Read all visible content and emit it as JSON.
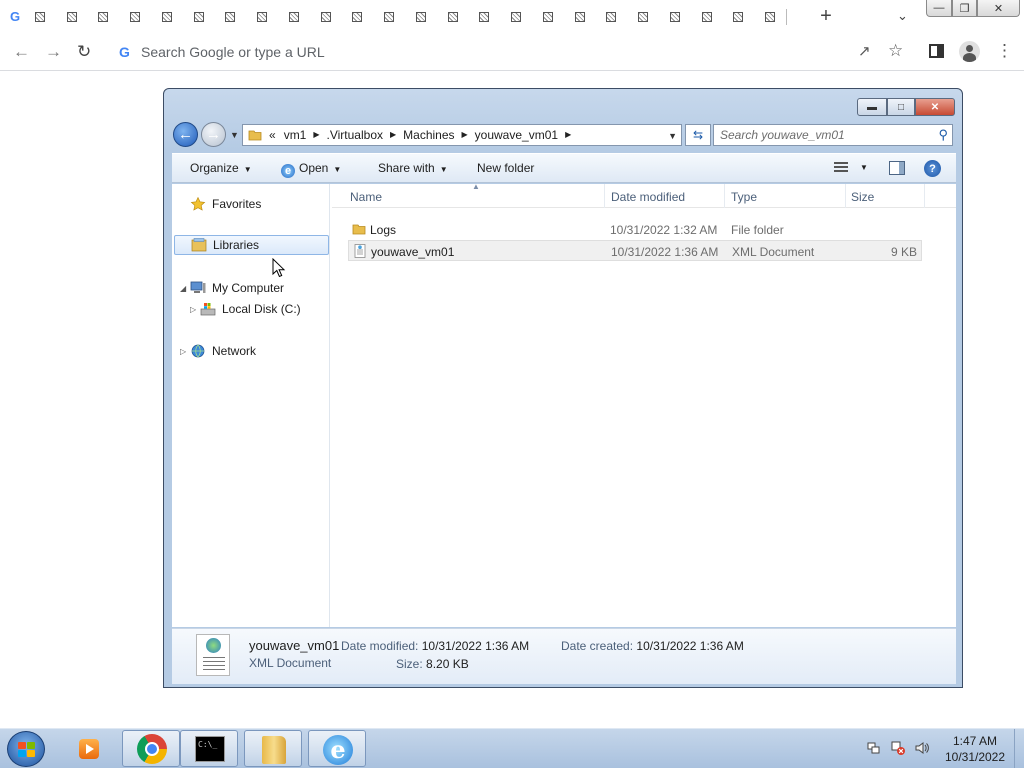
{
  "browser": {
    "tab_favicon": "google-icon",
    "tab_count_visible": 24,
    "omnibox": {
      "placeholder": "Search Google or type a URL",
      "value": ""
    }
  },
  "explorer": {
    "breadcrumb": {
      "overflow": "«",
      "items": [
        "vm1",
        ".Virtualbox",
        "Machines",
        "youwave_vm01"
      ]
    },
    "search": {
      "placeholder": "Search youwave_vm01"
    },
    "commands": {
      "organize": "Organize",
      "open": "Open",
      "share_with": "Share with",
      "new_folder": "New folder"
    },
    "nav": {
      "favorites": "Favorites",
      "libraries": "Libraries",
      "my_computer": "My Computer",
      "local_disk": "Local Disk (C:)",
      "network": "Network"
    },
    "columns": {
      "name": "Name",
      "date": "Date modified",
      "type": "Type",
      "size": "Size"
    },
    "files": [
      {
        "name": "Logs",
        "date": "10/31/2022 1:32 AM",
        "type": "File folder",
        "size": "",
        "icon": "folder-icon"
      },
      {
        "name": "youwave_vm01",
        "date": "10/31/2022 1:36 AM",
        "type": "XML Document",
        "size": "9 KB",
        "icon": "xml-file-icon"
      }
    ],
    "details": {
      "name": "youwave_vm01",
      "type": "XML Document",
      "modified_label": "Date modified:",
      "modified": "10/31/2022 1:36 AM",
      "created_label": "Date created:",
      "created": "10/31/2022 1:36 AM",
      "size_label": "Size:",
      "size": "8.20 KB"
    }
  },
  "taskbar": {
    "time": "1:47 AM",
    "date": "10/31/2022"
  },
  "colors": {
    "explorer_frame": "#b5cbe4",
    "selection_border": "#8eb6e6",
    "taskbar": "#a9c1de",
    "google_blue": "#4285f4"
  }
}
